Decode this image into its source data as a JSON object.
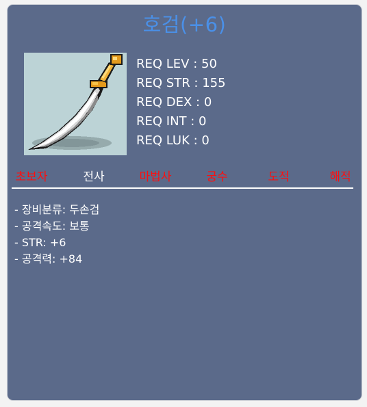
{
  "item": {
    "name": "호검(+6)",
    "requirements": [
      {
        "text": "REQ LEV : 50"
      },
      {
        "text": "REQ STR : 155"
      },
      {
        "text": "REQ DEX : 0"
      },
      {
        "text": "REQ INT : 0"
      },
      {
        "text": "REQ LUK : 0"
      }
    ],
    "jobs": [
      {
        "label": "초보자",
        "color": "#ff0e0e"
      },
      {
        "label": "전사",
        "color": "#ffffff"
      },
      {
        "label": "마법사",
        "color": "#ff0e0e"
      },
      {
        "label": "궁수",
        "color": "#ff0e0e"
      },
      {
        "label": "도적",
        "color": "#ff0e0e"
      },
      {
        "label": "해적",
        "color": "#ff0e0e"
      }
    ],
    "stats": [
      {
        "text": "- 장비분류: 두손검"
      },
      {
        "text": "- 공격속도: 보통"
      },
      {
        "text": "- STR: +6"
      },
      {
        "text": "- 공격력: +84"
      }
    ],
    "icon": "two-handed-sword-icon"
  },
  "colors": {
    "panel": "#5b6a8a",
    "title": "#4a90e8",
    "job_unavailable": "#ff0e0e",
    "job_available": "#ffffff"
  }
}
